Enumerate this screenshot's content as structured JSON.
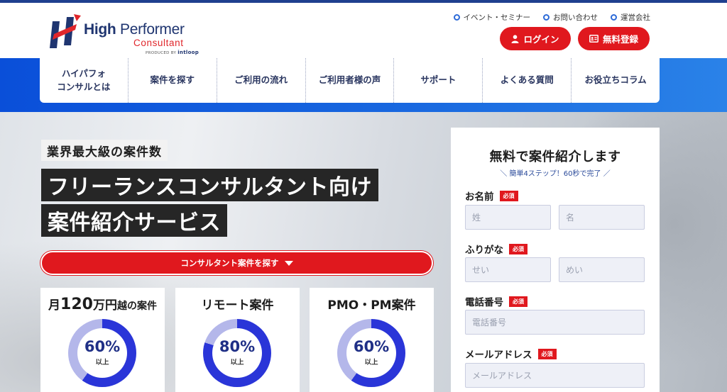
{
  "brand": {
    "name_bold": "High",
    "name_rest": " Performer",
    "sub": "Consultant",
    "produced_by": "PRODUCED BY",
    "company": "intloop"
  },
  "utility_links": [
    {
      "label": "イベント・セミナー"
    },
    {
      "label": "お問い合わせ"
    },
    {
      "label": "運営会社"
    }
  ],
  "header_buttons": {
    "login": "ログイン",
    "register": "無料登録"
  },
  "nav": [
    {
      "label": "ハイパフォ\nコンサルとは"
    },
    {
      "label": "案件を探す"
    },
    {
      "label": "ご利用の流れ"
    },
    {
      "label": "ご利用者様の声"
    },
    {
      "label": "サポート"
    },
    {
      "label": "よくある質問"
    },
    {
      "label": "お役立ちコラム"
    }
  ],
  "hero": {
    "tag": "業界最大級の案件数",
    "headline1": "フリーランスコンサルタント向け",
    "headline2": "案件紹介サービス",
    "cta": "コンサルタント案件を探す"
  },
  "stats": [
    {
      "title_pre": "月",
      "title_num": "120",
      "title_unit": "万円",
      "title_post": "越の案件",
      "percent": 60,
      "percent_label": "60%",
      "sub": "以上"
    },
    {
      "title": "リモート案件",
      "percent": 80,
      "percent_label": "80%",
      "sub": "以上"
    },
    {
      "title": "PMO・PM案件",
      "percent": 60,
      "percent_label": "60%",
      "sub": "以上"
    }
  ],
  "form": {
    "title": "無料で案件紹介します",
    "subtitle": "＼ 簡単4ステップ！60秒で完了 ／",
    "required": "必須",
    "name_label": "お名前",
    "last_name_ph": "姓",
    "first_name_ph": "名",
    "kana_label": "ふりがな",
    "last_kana_ph": "せい",
    "first_kana_ph": "めい",
    "phone_label": "電話番号",
    "phone_ph": "電話番号",
    "email_label": "メールアドレス",
    "email_ph": "メールアドレス"
  },
  "colors": {
    "accent_red": "#e0181e",
    "nav_blue": "#0a4fd9",
    "ring_dark": "#2a35d8",
    "ring_light": "#b4b7ea"
  }
}
